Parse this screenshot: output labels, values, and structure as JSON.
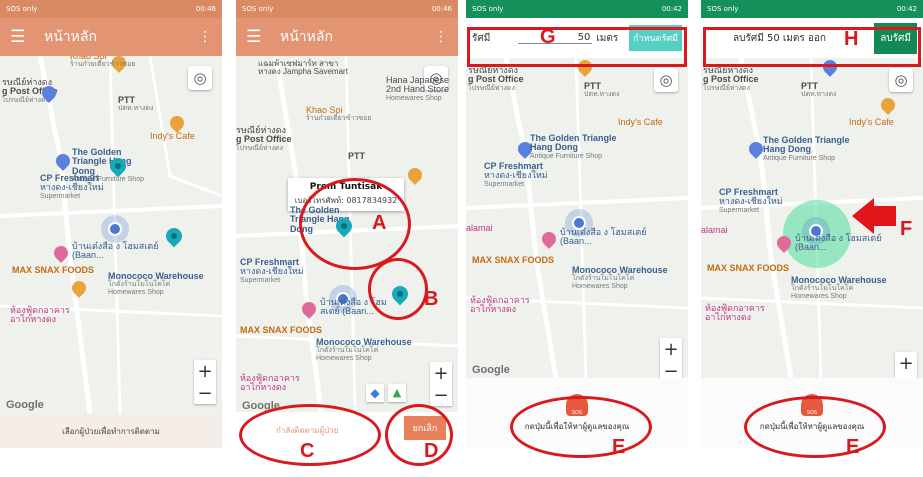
{
  "status": {
    "screen1": {
      "left": "SOS only",
      "right": "00:46"
    },
    "screen2": {
      "left": "SOS only",
      "right": "00:46"
    },
    "screen3": {
      "left": "SOS only",
      "right": "00:42"
    },
    "screen4": {
      "left": "SOS only",
      "right": "00:42"
    }
  },
  "appbar": {
    "title": "หน้าหลัก",
    "menu_icon": "☰",
    "more_icon": "⋮"
  },
  "map_labels": {
    "khao_soi": "Khao Soi",
    "khao_soi_sub": "ร้านก๋วยเตี๋ยวข้าวซอย",
    "post_office": "g Post Office",
    "post_office_th": "รษณีย์ห่างดง",
    "post_office_sub": "ไปรษณีย์ห่างดง",
    "ptt": "PTT",
    "ptt_sub": "ปตท.หางดง",
    "indys": "Indy's Cafe",
    "golden": "The Golden Triangle Hang Dong",
    "golden_sub": "Antique Furniture Shop",
    "cp": "CP Freshmart",
    "cp_th": "หางดง-เชียงใหม่",
    "cp_sub": "Supermarket",
    "baan": "บ้านเต๋งสือ ง โฮมสเตย์ (Baan...",
    "maxsnax": "MAX SNAX FOODS",
    "monococo": "Monococo Warehouse",
    "monococo_th": "โกดังร้านโมโนโคโค่",
    "monococo_sub": "Homewares Shop",
    "food_court": "ห้องฟู้ดกอาคาร อาไก่หางดง",
    "jampha": "แฉมพ้าเซฟมาร์ท สาขา หางดง Jampha Savemart",
    "hana": "Hana Japanese 2nd Hand Store",
    "hana_sub": "Homewares Shop",
    "alamai": "alamai"
  },
  "google_label": "Google",
  "zoom": {
    "plus": "+",
    "minus": "−"
  },
  "screen1": {
    "bottom_text": "เลือกผู้ป่วยเพื่อทำการติดตาม"
  },
  "screen2": {
    "callout_name": "Prem Tuntisak",
    "callout_phone": "เบอร์โทรศัพท์: 0817834932",
    "track_button": "กำลังติดตามผู้ป่วย",
    "cancel_button": "ยกเลิก"
  },
  "screen3": {
    "radius_label": "รัศมี",
    "radius_value": "50",
    "radius_unit": "เมตร",
    "set_button": "กำหนดรัศมี",
    "sos_text": "กดปุ่มนี้เพื่อให้หาผู้ดูแลของคุณ",
    "sos_icon_text": "SOS"
  },
  "screen4": {
    "radius_info": "ลบรัศมี  50 เมตร  ออก",
    "delete_button": "ลบรัศมี",
    "sos_text": "กดปุ่มนี้เพื่อให้หาผู้ดูแลของคุณ",
    "sos_icon_text": "SOS"
  },
  "annotations": {
    "A": "A",
    "B": "B",
    "C": "C",
    "D": "D",
    "E": "E",
    "F": "F",
    "G": "G",
    "H": "H"
  },
  "colors": {
    "annotation_red": "#d8191e",
    "appbar": "#e29473",
    "teal_pin": "#17a9b8",
    "green_bar": "#15905a"
  }
}
